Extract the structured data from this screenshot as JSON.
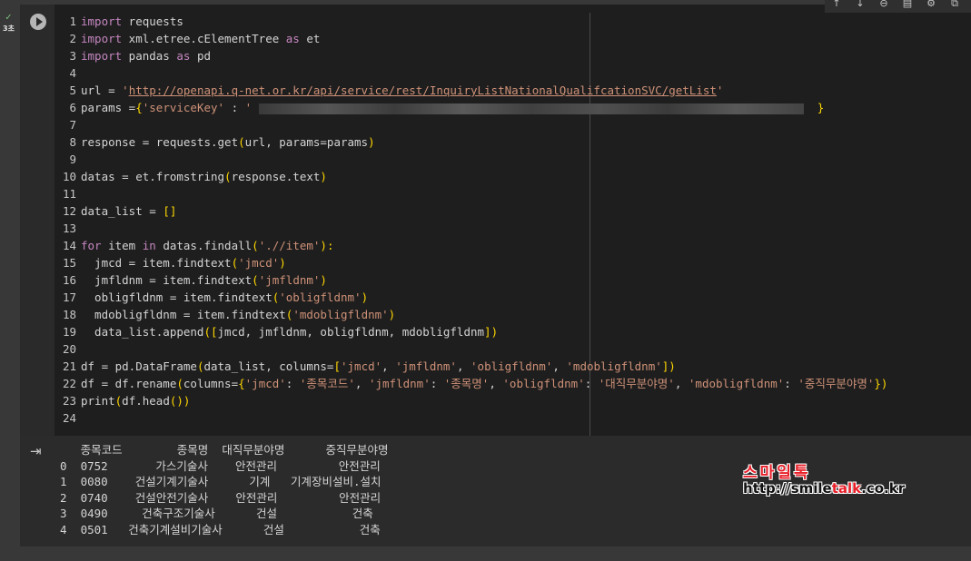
{
  "run": {
    "status_check": "✓",
    "exec_time": "3초"
  },
  "toolbar": [
    "↑",
    "↓",
    "⊖",
    "▤",
    "⚙",
    "⧉"
  ],
  "code_lines": [
    {
      "n": "1"
    },
    {
      "n": "2"
    },
    {
      "n": "3"
    },
    {
      "n": "4"
    },
    {
      "n": "5"
    },
    {
      "n": "6"
    },
    {
      "n": "7"
    },
    {
      "n": "8"
    },
    {
      "n": "9"
    },
    {
      "n": "10"
    },
    {
      "n": "11"
    },
    {
      "n": "12"
    },
    {
      "n": "13"
    },
    {
      "n": "14"
    },
    {
      "n": "15"
    },
    {
      "n": "16"
    },
    {
      "n": "17"
    },
    {
      "n": "18"
    },
    {
      "n": "19"
    },
    {
      "n": "20"
    },
    {
      "n": "21"
    },
    {
      "n": "22"
    },
    {
      "n": "23"
    },
    {
      "n": "24"
    }
  ],
  "code": {
    "l1": [
      "import",
      " requests"
    ],
    "l2": [
      "import",
      " xml.etree.cElementTree ",
      "as",
      " et"
    ],
    "l3": [
      "import",
      " pandas ",
      "as",
      " pd"
    ],
    "l5": [
      "url = ",
      "'",
      "http://openapi.q-net.or.kr/api/service/rest/InquiryListNationalQualifcationSVC/getList",
      "'"
    ],
    "l6": [
      "params =",
      "{",
      "'serviceKey'",
      " : ",
      "'",
      "}"
    ],
    "l8": [
      "response = requests.get",
      "(",
      "url, params=params",
      ")"
    ],
    "l10": [
      "datas = et.fromstring",
      "(",
      "response.text",
      ")"
    ],
    "l12": [
      "data_list = ",
      "[]"
    ],
    "l14": [
      "for",
      " item ",
      "in",
      " datas.findall",
      "(",
      "'.//item'",
      "):"
    ],
    "l15": [
      "  jmcd = item.findtext",
      "(",
      "'jmcd'",
      ")"
    ],
    "l16": [
      "  jmfldnm = item.findtext",
      "(",
      "'jmfldnm'",
      ")"
    ],
    "l17": [
      "  obligfldnm = item.findtext",
      "(",
      "'obligfldnm'",
      ")"
    ],
    "l18": [
      "  mdobligfldnm = item.findtext",
      "(",
      "'mdobligfldnm'",
      ")"
    ],
    "l19": [
      "  data_list.append",
      "(",
      "[",
      "jmcd, jmfldnm, obligfldnm, mdobligfldnm",
      "]",
      ")"
    ],
    "l21": [
      "df = pd.DataFrame",
      "(",
      "data_list, columns=",
      "[",
      "'jmcd'",
      ", ",
      "'jmfldnm'",
      ", ",
      "'obligfldnm'",
      ", ",
      "'mdobligfldnm'",
      "]",
      ")"
    ],
    "l22": [
      "df = df.rename",
      "(",
      "columns=",
      "{",
      "'jmcd'",
      ": ",
      "'종목코드'",
      ", ",
      "'jmfldnm'",
      ": ",
      "'종목명'",
      ", ",
      "'obligfldnm'",
      ": ",
      "'대직무분야명'",
      ", ",
      "'mdobligfldnm'",
      ": ",
      "'중직무분야명'",
      "}",
      ")"
    ],
    "l23": [
      "print",
      "(",
      "df.head",
      "()",
      ")"
    ]
  },
  "output": {
    "header": "   종목코드        종목명  대직무분야명      중직무분야명",
    "rows": [
      "0  0752       가스기술사    안전관리         안전관리",
      "1  0080    건설기계기술사      기계   기계장비설비.설치",
      "2  0740    건설안전기술사    안전관리         안전관리",
      "3  0490     건축구조기술사      건설           건축",
      "4  0501   건축기계설비기술사      건설           건축"
    ]
  },
  "watermark": {
    "title": "스마일톡",
    "url_prefix": "http://smile",
    "url_accent": "talk",
    "url_suffix": ".co.kr"
  }
}
